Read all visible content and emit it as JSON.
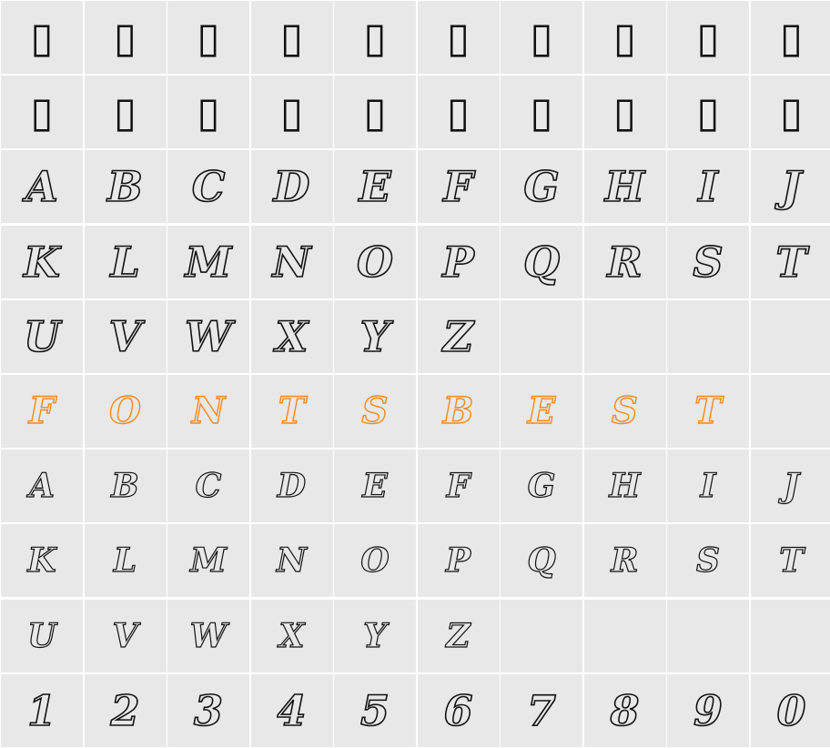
{
  "colors": {
    "cell_background": "#e8e8e8",
    "grid_lines": "#ffffff",
    "glyph_outline": "#111111",
    "highlight": "#f28a1e"
  },
  "rows": [
    [
      "▯",
      "▯",
      "▯",
      "▯",
      "▯",
      "▯",
      "▯",
      "▯",
      "▯",
      "▯"
    ],
    [
      "▯",
      "▯",
      "▯",
      "▯",
      "▯",
      "▯",
      "▯",
      "▯",
      "▯",
      "▯"
    ],
    [
      "A",
      "B",
      "C",
      "D",
      "E",
      "F",
      "G",
      "H",
      "I",
      "J"
    ],
    [
      "K",
      "L",
      "M",
      "N",
      "O",
      "P",
      "Q",
      "R",
      "S",
      "T"
    ],
    [
      "U",
      "V",
      "W",
      "X",
      "Y",
      "Z",
      "",
      "",
      "",
      ""
    ],
    [
      "F",
      "O",
      "N",
      "T",
      "S",
      "B",
      "E",
      "S",
      "T",
      ""
    ],
    [
      "A",
      "B",
      "C",
      "D",
      "E",
      "F",
      "G",
      "H",
      "I",
      "J"
    ],
    [
      "K",
      "L",
      "M",
      "N",
      "O",
      "P",
      "Q",
      "R",
      "S",
      "T"
    ],
    [
      "U",
      "V",
      "W",
      "X",
      "Y",
      "Z",
      "",
      "",
      "",
      ""
    ],
    [
      "1",
      "2",
      "3",
      "4",
      "5",
      "6",
      "7",
      "8",
      "9",
      "0"
    ]
  ]
}
